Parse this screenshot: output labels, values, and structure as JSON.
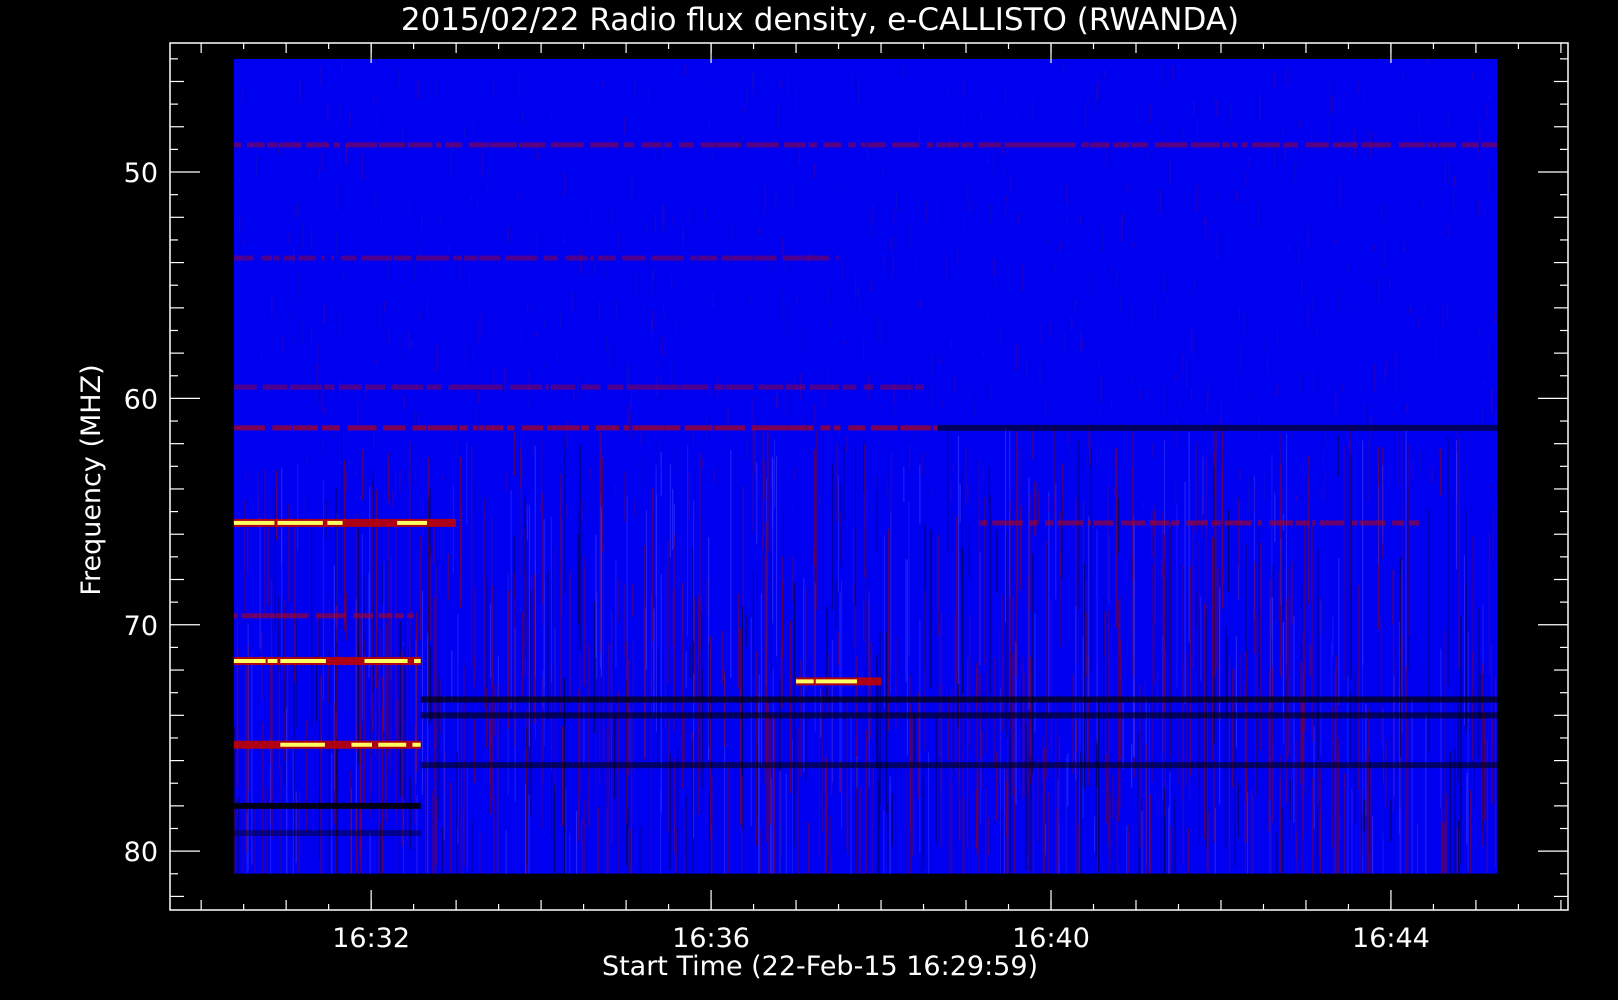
{
  "chart_data": {
    "type": "heatmap",
    "title": "2015/02/22  Radio flux density, e-CALLISTO (RWANDA)",
    "xlabel": "Start Time (22-Feb-15 16:29:59)",
    "ylabel": "Frequency (MHZ)",
    "x_range": [
      "16:30:23",
      "16:45:15"
    ],
    "y_range": [
      45,
      81
    ],
    "y_inverted": true,
    "x_axis_range": [
      "16:29:38",
      "16:46:05"
    ],
    "y_axis_range": [
      44.3,
      82.6
    ],
    "x_ticks": [
      "16:32",
      "16:36",
      "16:40",
      "16:44"
    ],
    "y_ticks": [
      50,
      60,
      70,
      80
    ],
    "grid": false,
    "colormap": {
      "background": "#0000f0",
      "low": "#000000",
      "mid": "#c00000",
      "high": "#ffff60"
    },
    "bands": [
      {
        "freq": 48.8,
        "start": "16:30:23",
        "end": "16:45:15",
        "intensity": 0.45
      },
      {
        "freq": 53.8,
        "start": "16:30:23",
        "end": "16:37:30",
        "intensity": 0.4
      },
      {
        "freq": 59.5,
        "start": "16:30:23",
        "end": "16:38:30",
        "intensity": 0.4
      },
      {
        "freq": 61.3,
        "start": "16:30:23",
        "end": "16:38:40",
        "intensity": 0.65
      },
      {
        "freq": 61.3,
        "start": "16:38:40",
        "end": "16:45:15",
        "intensity": -0.6
      },
      {
        "freq": 65.5,
        "start": "16:30:23",
        "end": "16:33:00",
        "intensity": 0.95
      },
      {
        "freq": 65.5,
        "start": "16:39:10",
        "end": "16:44:20",
        "intensity": 0.55
      },
      {
        "freq": 69.6,
        "start": "16:30:23",
        "end": "16:32:30",
        "intensity": 0.55
      },
      {
        "freq": 71.6,
        "start": "16:30:23",
        "end": "16:32:35",
        "intensity": 1.0
      },
      {
        "freq": 72.5,
        "start": "16:37:00",
        "end": "16:38:00",
        "intensity": 0.95
      },
      {
        "freq": 73.3,
        "start": "16:32:35",
        "end": "16:45:15",
        "intensity": -0.7
      },
      {
        "freq": 74.0,
        "start": "16:32:35",
        "end": "16:45:15",
        "intensity": -0.6
      },
      {
        "freq": 75.3,
        "start": "16:30:23",
        "end": "16:32:35",
        "intensity": 1.0
      },
      {
        "freq": 76.2,
        "start": "16:32:35",
        "end": "16:45:15",
        "intensity": -0.55
      },
      {
        "freq": 78.0,
        "start": "16:30:23",
        "end": "16:32:35",
        "intensity": -0.9
      },
      {
        "freq": 79.2,
        "start": "16:30:23",
        "end": "16:32:35",
        "intensity": -0.4
      }
    ]
  }
}
